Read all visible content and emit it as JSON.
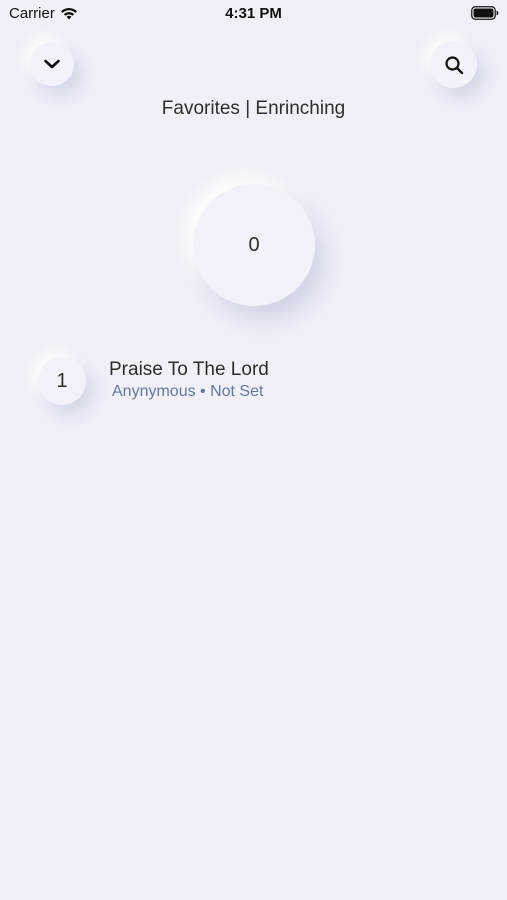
{
  "status_bar": {
    "carrier": "Carrier",
    "time": "4:31 PM",
    "icons": [
      "wifi-icon",
      "battery-icon"
    ]
  },
  "header": {
    "back_icon": "chevron-down-icon",
    "search_icon": "search-icon",
    "title": "Favorites | Enrinching"
  },
  "counter": {
    "value": "0"
  },
  "songs": [
    {
      "number": "1",
      "title": "Praise To The Lord",
      "meta": "Anynymous • Not Set"
    }
  ],
  "colors": {
    "background": "#eff0f8",
    "meta_text": "#66779a"
  }
}
